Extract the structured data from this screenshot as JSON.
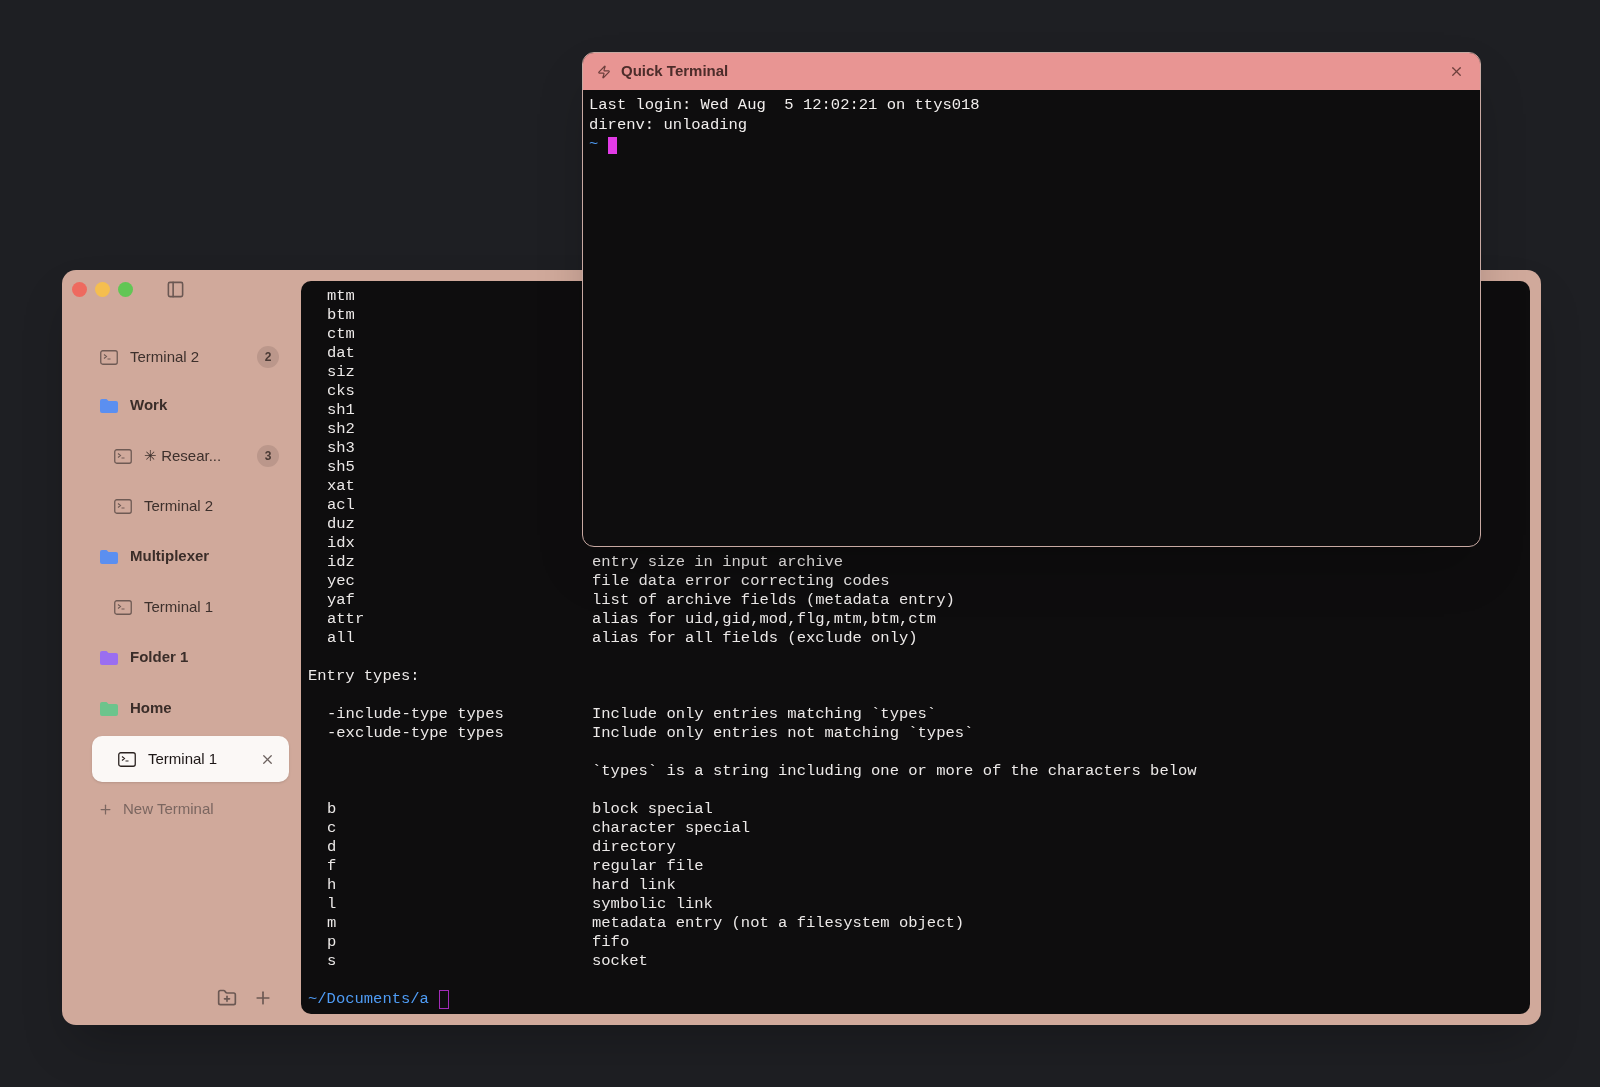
{
  "main_window": {
    "sidebar": {
      "items": [
        {
          "kind": "terminal",
          "label": "Terminal 2",
          "badge": "2",
          "selected": false
        },
        {
          "kind": "folder",
          "label": "Work",
          "color": "#5b8ff0",
          "children": [
            {
              "kind": "terminal",
              "label": "✳ Resear...",
              "badge": "3",
              "selected": false
            },
            {
              "kind": "terminal",
              "label": "Terminal 2",
              "selected": false
            }
          ]
        },
        {
          "kind": "folder",
          "label": "Multiplexer",
          "color": "#5b8ff0",
          "children": [
            {
              "kind": "terminal",
              "label": "Terminal 1",
              "selected": false
            }
          ]
        },
        {
          "kind": "folder",
          "label": "Folder 1",
          "color": "#9a6ef0"
        },
        {
          "kind": "folder",
          "label": "Home",
          "color": "#6cc48c",
          "children": [
            {
              "kind": "terminal",
              "label": "Terminal 1",
              "selected": true
            }
          ]
        }
      ],
      "new_terminal": "New Terminal"
    },
    "terminal": {
      "sections": [
        {
          "rows": [
            {
              "name": "mtm"
            },
            {
              "name": "btm"
            },
            {
              "name": "ctm"
            },
            {
              "name": "dat"
            },
            {
              "name": "siz"
            },
            {
              "name": "cks"
            },
            {
              "name": "sh1"
            },
            {
              "name": "sh2"
            },
            {
              "name": "sh3"
            },
            {
              "name": "sh5"
            },
            {
              "name": "xat"
            },
            {
              "name": "acl"
            },
            {
              "name": "duz"
            },
            {
              "name": "idx"
            },
            {
              "name": "idz",
              "description": "entry size in input archive"
            },
            {
              "name": "yec",
              "description": "file data error correcting codes"
            },
            {
              "name": "yaf",
              "description": "list of archive fields (metadata entry)"
            },
            {
              "name": "attr",
              "description": "alias for uid,gid,mod,flg,mtm,btm,ctm"
            },
            {
              "name": "all",
              "description": "alias for all fields (exclude only)"
            }
          ]
        },
        {
          "heading": "Entry types:",
          "rows": [
            {
              "name": "-include-type types",
              "description": "Include only entries matching `types`"
            },
            {
              "name": "-exclude-type types",
              "description": "Include only entries not matching `types`"
            }
          ]
        },
        {
          "rows": [
            {
              "description": "`types` is a string including one or more of the characters below"
            }
          ]
        },
        {
          "rows": [
            {
              "name": "b",
              "description": "block special"
            },
            {
              "name": "c",
              "description": "character special"
            },
            {
              "name": "d",
              "description": "directory"
            },
            {
              "name": "f",
              "description": "regular file"
            },
            {
              "name": "h",
              "description": "hard link"
            },
            {
              "name": "l",
              "description": "symbolic link"
            },
            {
              "name": "m",
              "description": "metadata entry (not a filesystem object)"
            },
            {
              "name": "p",
              "description": "fifo"
            },
            {
              "name": "s",
              "description": "socket"
            }
          ]
        }
      ],
      "prompt": "~/Documents/a",
      "cursor_focused": false
    }
  },
  "quick_terminal": {
    "title": "Quick Terminal",
    "lines": [
      "Last login: Wed Aug  5 12:02:21 on ttys018",
      "direnv: unloading"
    ],
    "prompt": "~",
    "cursor_focused": true
  }
}
